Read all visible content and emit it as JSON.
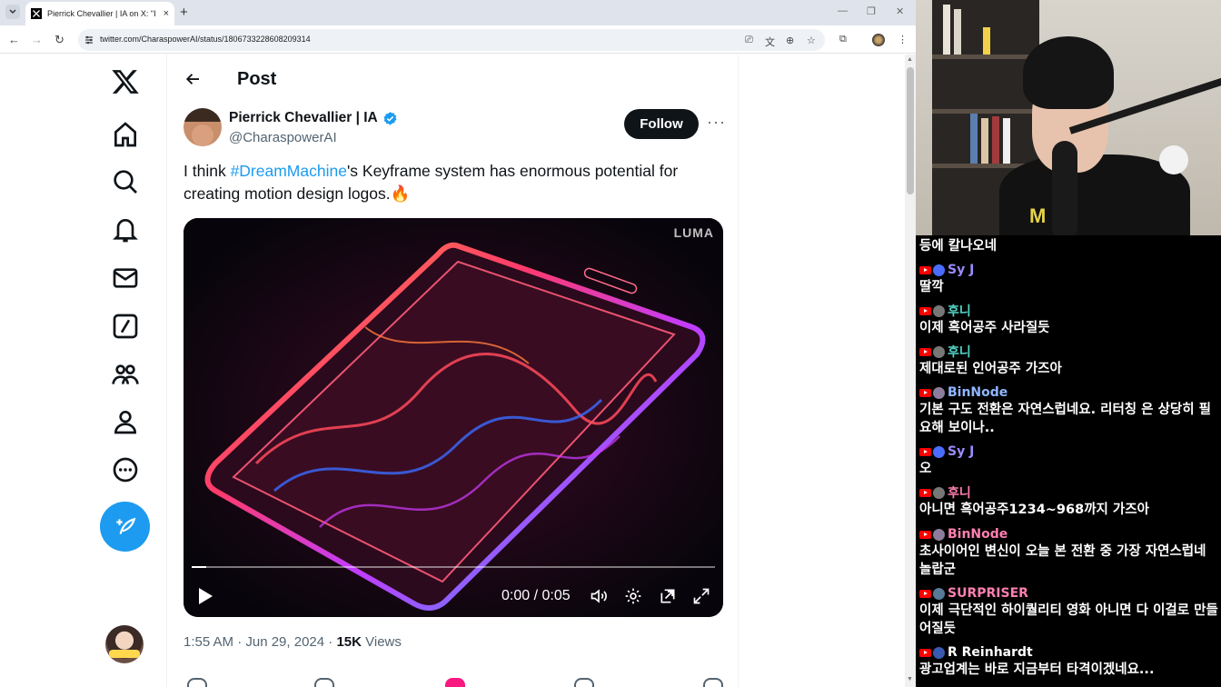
{
  "browser": {
    "tab_title": "Pierrick Chevallier | IA on X: \"I",
    "tab_close": "×",
    "new_tab": "+",
    "url": "twitter.com/CharaspowerAI/status/1806733228608209314"
  },
  "x_page": {
    "header_title": "Post",
    "author": {
      "name": "Pierrick Chevallier | IA",
      "handle": "@CharaspowerAI",
      "verified": true
    },
    "follow_label": "Follow",
    "more_label": "···",
    "tweet": {
      "text_before": "I think ",
      "hashtag": "#DreamMachine",
      "text_after": "'s Keyframe system has enormous potential for creating motion design logos.🔥"
    },
    "video": {
      "watermark": "LUMA",
      "timecode": "0:00 / 0:05",
      "progress": 0.027
    },
    "meta": {
      "time": "1:55 AM · Jun 29, 2024 · ",
      "views_count": "15K",
      "views_label": " Views"
    },
    "colors": {
      "accent": "#1d9bf0",
      "text": "#0f1419",
      "secondary": "#536471"
    }
  },
  "stream": {
    "shirt_text": "M",
    "chat": [
      {
        "user": null,
        "text": "등에 칼나오네"
      },
      {
        "user": "Sy J",
        "color": "#9b8cff",
        "avatar": "#4a6cff",
        "text": "딸깍"
      },
      {
        "user": "후니",
        "color": "#53d6c8",
        "avatar": "#777777",
        "text": "이제 흑어공주 사라질듯"
      },
      {
        "user": "후니",
        "color": "#53d6c8",
        "avatar": "#777777",
        "text": "제대로된 인어공주 가즈아"
      },
      {
        "user": "BinNode",
        "color": "#8fb7ff",
        "avatar": "#8b7d9b",
        "text": "기본 구도 전환은 자연스럽네요. 리터칭 은 상당히 필요해 보이나.."
      },
      {
        "user": "Sy J",
        "color": "#9b8cff",
        "avatar": "#4a6cff",
        "text": "오"
      },
      {
        "user": "후니",
        "color": "#ff7fb0",
        "avatar": "#777777",
        "text": "아니면 흑어공주1234~968까지 가즈아"
      },
      {
        "user": "BinNode",
        "color": "#ff7fb0",
        "avatar": "#8b7d9b",
        "text": "초사이어인 변신이 오늘 본 전환 중 가장 자연스럽네 놀랍군"
      },
      {
        "user": "SURPRISER",
        "color": "#ff7fb0",
        "avatar": "#5a7a99",
        "text": "이제 극단적인 하이퀄리티 영화 아니면 다 이걸로 만들어질듯"
      },
      {
        "user": "R Reinhardt",
        "color": "#ffffff",
        "avatar": "#3a5ab0",
        "text": "광고업계는 바로 지금부터 타격이겠네요..."
      }
    ]
  }
}
